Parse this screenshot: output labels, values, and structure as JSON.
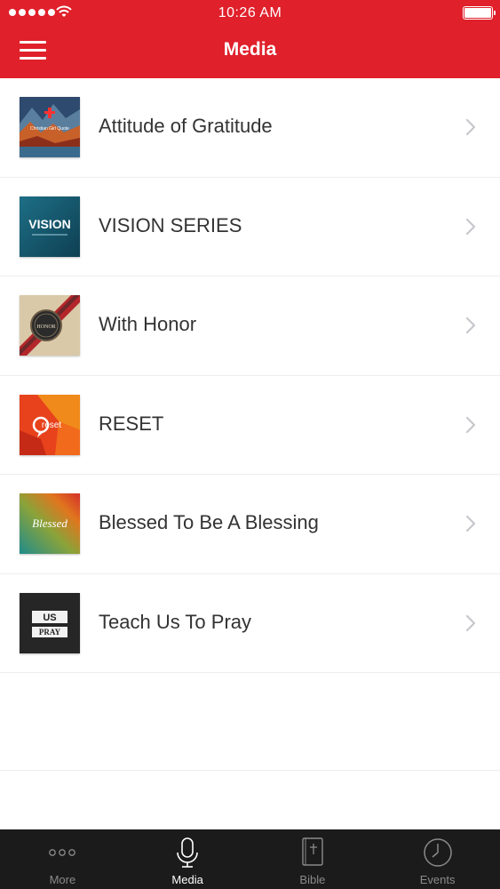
{
  "status_bar": {
    "time": "10:26 AM"
  },
  "header": {
    "title": "Media"
  },
  "media_items": [
    {
      "title": "Attitude of Gratitude",
      "thumb_caption": "Christian Girl Quote"
    },
    {
      "title": "VISION SERIES",
      "thumb_caption": "VISION"
    },
    {
      "title": "With Honor",
      "thumb_caption": "HONOR"
    },
    {
      "title": "RESET",
      "thumb_caption": "reset"
    },
    {
      "title": "Blessed To Be A Blessing",
      "thumb_caption": "Blessed"
    },
    {
      "title": "Teach Us To Pray",
      "thumb_caption_top": "US",
      "thumb_caption_bottom": "PRAY"
    }
  ],
  "tab_bar": {
    "tabs": [
      {
        "label": "More",
        "icon": "more-dots-icon",
        "active": false
      },
      {
        "label": "Media",
        "icon": "microphone-icon",
        "active": true
      },
      {
        "label": "Bible",
        "icon": "bible-book-icon",
        "active": false
      },
      {
        "label": "Events",
        "icon": "clock-icon",
        "active": false
      }
    ]
  },
  "colors": {
    "accent": "#e0202b",
    "tab_bar_bg": "#1b1b1b",
    "tab_active": "#ffffff",
    "tab_inactive": "#8a8a8a"
  }
}
